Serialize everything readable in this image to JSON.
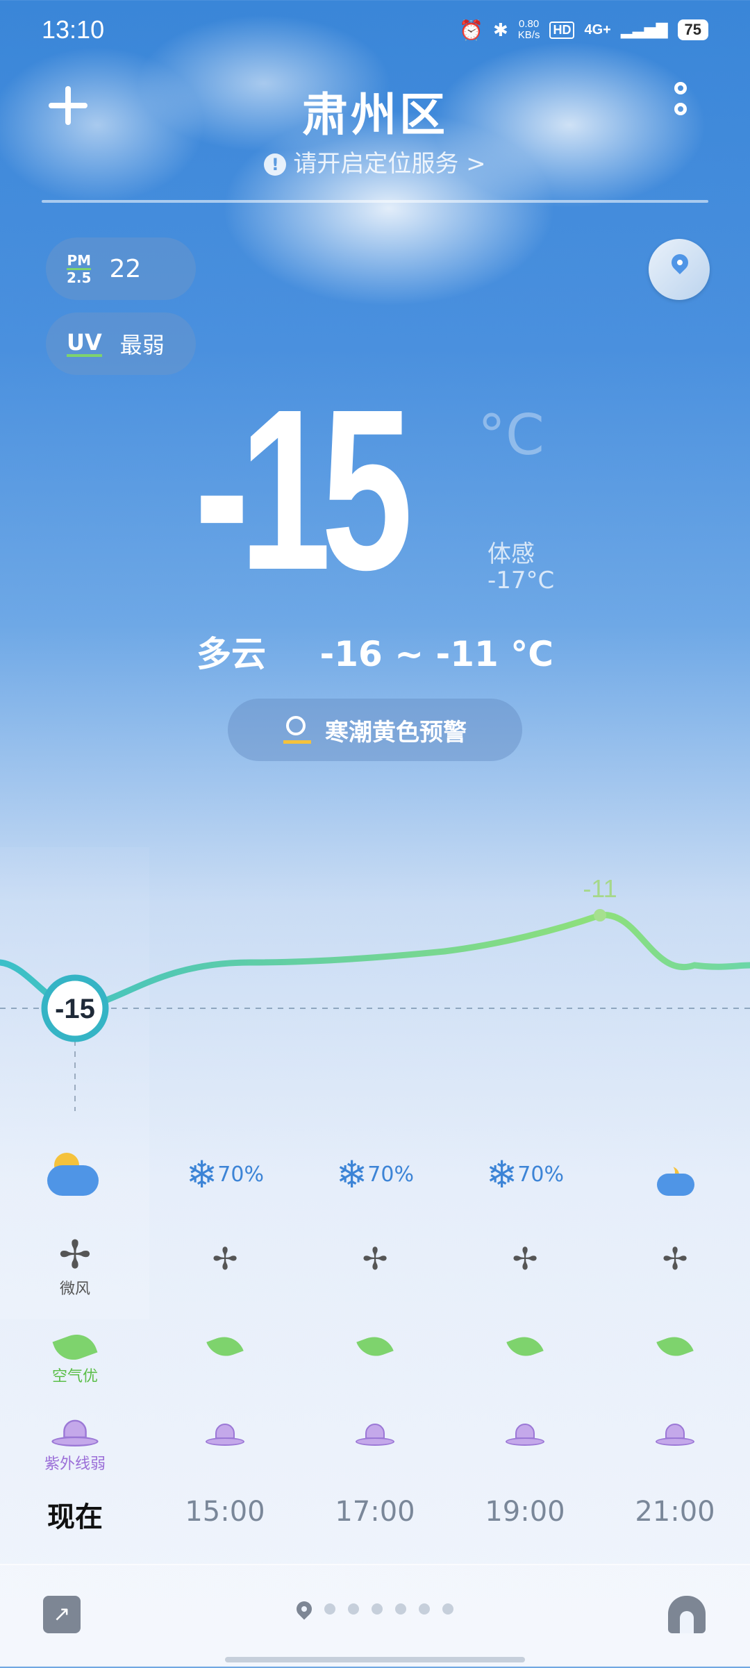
{
  "status_bar": {
    "time": "13:10",
    "net_speed_value": "0.80",
    "net_speed_unit": "KB/s",
    "hd": "HD",
    "network": "4G+",
    "battery": "75"
  },
  "header": {
    "city": "肃州区",
    "location_hint": "请开启定位服务 >"
  },
  "air": {
    "pm_top": "PM",
    "pm_bottom": "2.5",
    "pm_value": "22",
    "uv_label": "UV",
    "uv_value": "最弱"
  },
  "current": {
    "temp": "-15",
    "unit": "°C",
    "feels_label": "体感",
    "feels_value": "-17°C",
    "condition": "多云",
    "range": "-16 ~ -11 °C",
    "alert": "寒潮黄色预警"
  },
  "trend": {
    "current_marker": "-15",
    "max_label": "-11"
  },
  "hourly": [
    {
      "time": "现在",
      "precip": "",
      "wind_label": "微风",
      "air_label": "空气优",
      "uv_label": "紫外线弱",
      "icon": "sun-cloud-icon"
    },
    {
      "time": "15:00",
      "precip": "70%",
      "icon": "snow-icon"
    },
    {
      "time": "17:00",
      "precip": "70%",
      "icon": "snow-icon"
    },
    {
      "time": "19:00",
      "precip": "70%",
      "icon": "snow-icon"
    },
    {
      "time": "21:00",
      "precip": "",
      "icon": "moon-cloud-icon"
    }
  ],
  "colors": {
    "accent": "#3c84d6",
    "curve_start": "#3bbfc9",
    "curve_end": "#8fe07a",
    "leaf": "#7ed36d",
    "uv": "#9b6fd8"
  }
}
